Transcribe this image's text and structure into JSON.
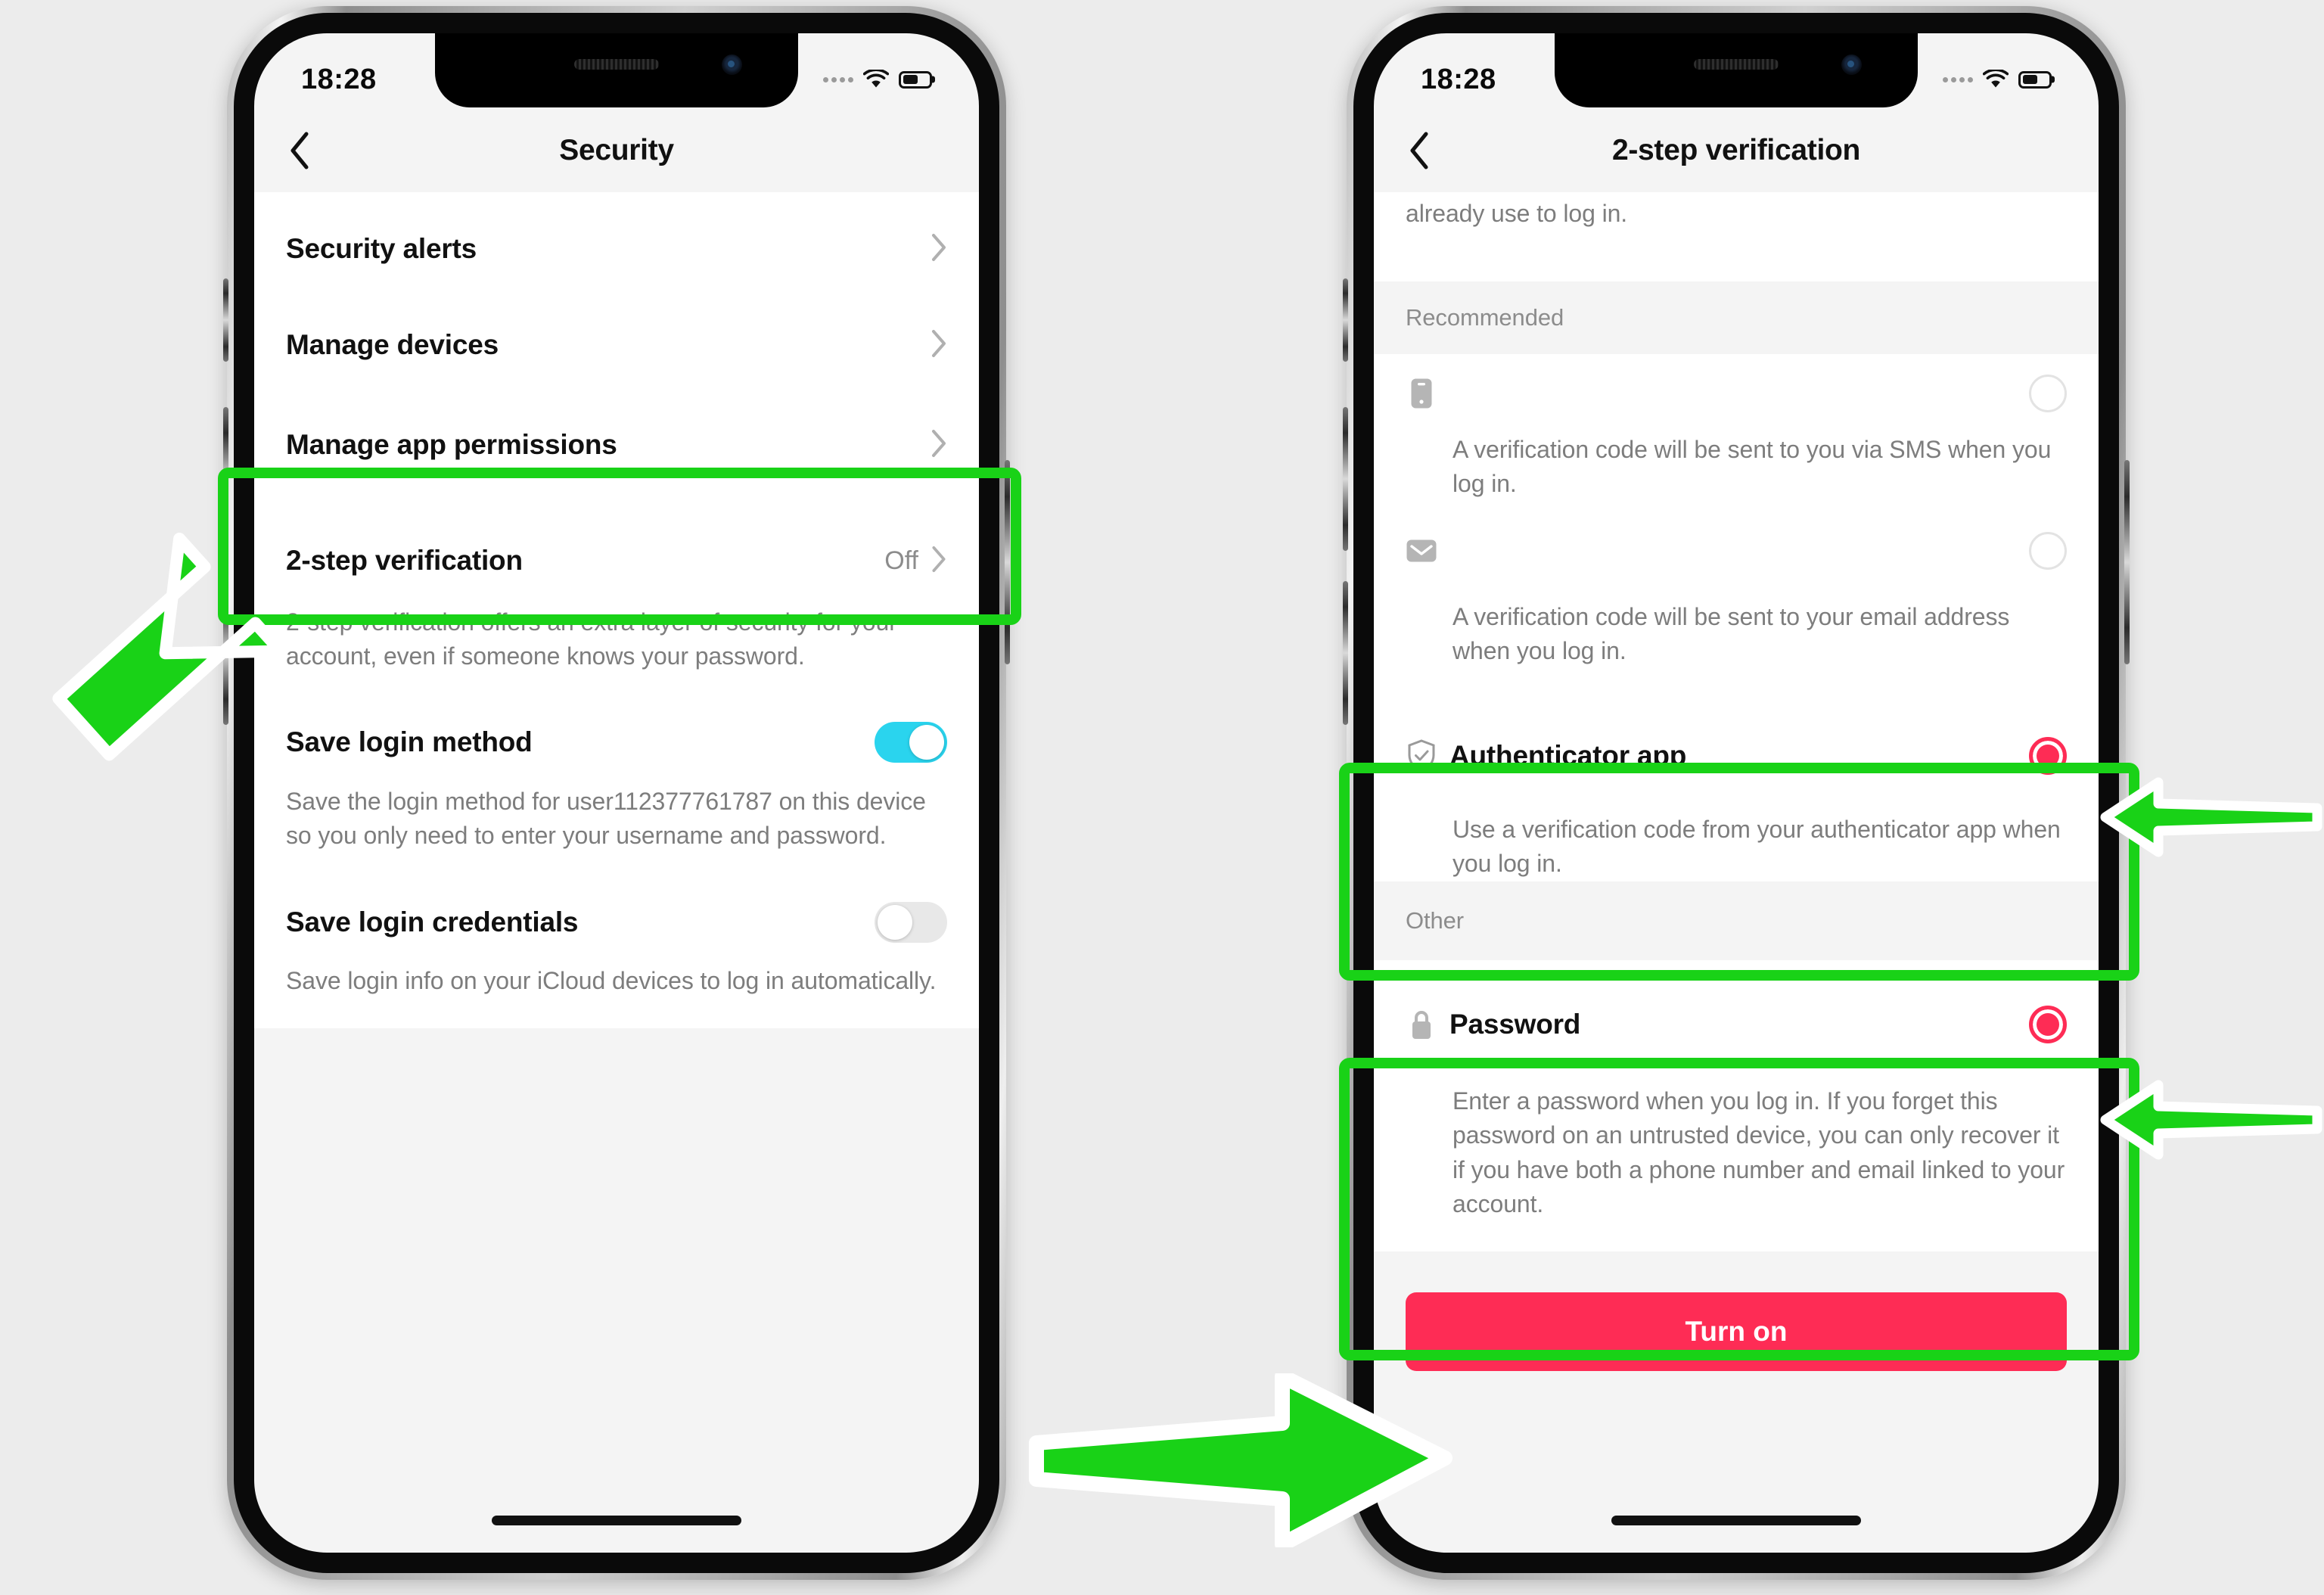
{
  "meta": {
    "background": "#ececec",
    "accent_green": "#19d217",
    "accent_red": "#fe2c55",
    "toggle_on_color": "#2ad4ee"
  },
  "phone_left": {
    "status": {
      "time": "18:28",
      "wifi_icon": "wifi-icon",
      "battery_icon": "battery-icon",
      "signal_icon": "signal-dots-icon"
    },
    "nav": {
      "back_icon": "chevron-left-icon",
      "title": "Security"
    },
    "rows": [
      {
        "title": "Security alerts",
        "chevron": "›"
      },
      {
        "title": "Manage devices",
        "chevron": "›"
      },
      {
        "title": "Manage app permissions",
        "chevron": "›"
      }
    ],
    "two_step": {
      "title": "2-step verification",
      "value": "Off",
      "chevron": "›",
      "desc": "2-step verification offers an extra layer of security for your account, even if someone knows your password."
    },
    "save_login_method": {
      "title": "Save login method",
      "toggle_state": "on",
      "desc": "Save the login method for user112377761787 on this device so you only need to enter your username and password."
    },
    "save_login_credentials": {
      "title": "Save login credentials",
      "toggle_state": "off",
      "desc": "Save login info on your iCloud devices to log in automatically."
    }
  },
  "phone_right": {
    "status": {
      "time": "18:28",
      "wifi_icon": "wifi-icon",
      "battery_icon": "battery-icon",
      "signal_icon": "signal-dots-icon"
    },
    "nav": {
      "back_icon": "chevron-left-icon",
      "title": "2-step verification"
    },
    "intro_partial": "already use to log in.",
    "section_recommended": "Recommended",
    "section_other": "Other",
    "options": [
      {
        "icon": "phone-icon",
        "title": "",
        "desc": "A verification code will be sent to you via SMS when you log in.",
        "radio": "empty"
      },
      {
        "icon": "envelope-icon",
        "title": "",
        "desc": "A verification code will be sent to your email address when you log in.",
        "radio": "empty"
      },
      {
        "icon": "shield-check-icon",
        "title": "Authenticator app",
        "desc": "Use a verification code from your authenticator app when you log in.",
        "radio": "checked"
      },
      {
        "icon": "lock-icon",
        "title": "Password",
        "desc": "Enter a password when you log in. If you forget this password on an untrusted device, you can only recover it if you have both a phone number and email linked to your account.",
        "radio": "checked"
      }
    ],
    "turn_on_button": "Turn on"
  },
  "annotations": {
    "highlight_boxes": [
      {
        "name": "highlight-2-step-verification"
      },
      {
        "name": "highlight-authenticator-app"
      },
      {
        "name": "highlight-password"
      }
    ],
    "arrows": [
      {
        "name": "arrow-to-2-step-verification",
        "direction": "up-right"
      },
      {
        "name": "arrow-to-authenticator-app",
        "direction": "left"
      },
      {
        "name": "arrow-to-password",
        "direction": "left"
      },
      {
        "name": "arrow-to-turn-on",
        "direction": "right"
      }
    ]
  }
}
